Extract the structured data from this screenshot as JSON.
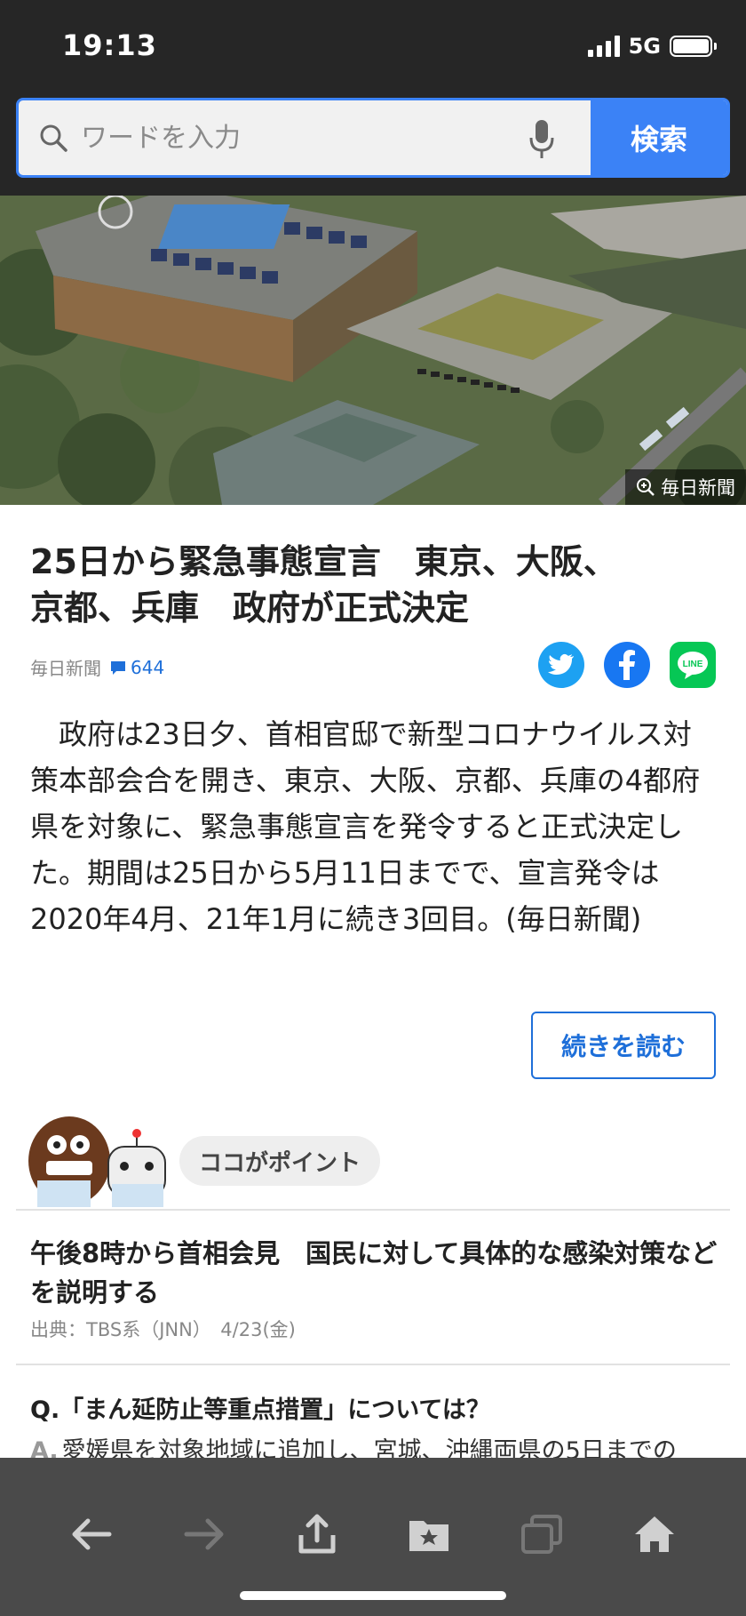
{
  "status_bar": {
    "time": "19:13",
    "network": "5G"
  },
  "search": {
    "placeholder": "ワードを入力",
    "button_label": "検索"
  },
  "hero": {
    "credit": "毎日新聞"
  },
  "article": {
    "headline_line1": "25日から緊急事態宣言　東京、大阪、",
    "headline_line2": "京都、兵庫　政府が正式決定",
    "source": "毎日新聞",
    "comment_count": "644",
    "body": "政府は23日夕、首相官邸で新型コロナウイルス対策本部会合を開き、東京、大阪、京都、兵庫の4都府県を対象に、緊急事態宣言を発令すると正式決定した。期間は25日から5月11日までで、宣言発令は2020年4月、21年1月に続き3回目。(毎日新聞)",
    "read_more_label": "続きを読む"
  },
  "point": {
    "bubble_label": "ココがポイント",
    "title": "午後8時から首相会見　国民に対して具体的な感染対策などを説明する",
    "source": "出典：TBS系（JNN）　4/23(金)",
    "question": "Q.「まん延防止等重点措置」については？",
    "answer_prefix": "A.",
    "answer": "愛媛県を対象地域に追加し、宮城、沖縄両県の5日までの"
  },
  "icons": {
    "back": "arrow-left-icon",
    "forward": "arrow-right-icon",
    "share": "share-icon",
    "bookmarks": "bookmark-folder-icon",
    "tabs": "tabs-icon",
    "home": "home-icon"
  },
  "colors": {
    "accent": "#3b82f6",
    "link": "#1e6fd9",
    "toolbar": "#4a4a4a",
    "header": "#262626"
  }
}
